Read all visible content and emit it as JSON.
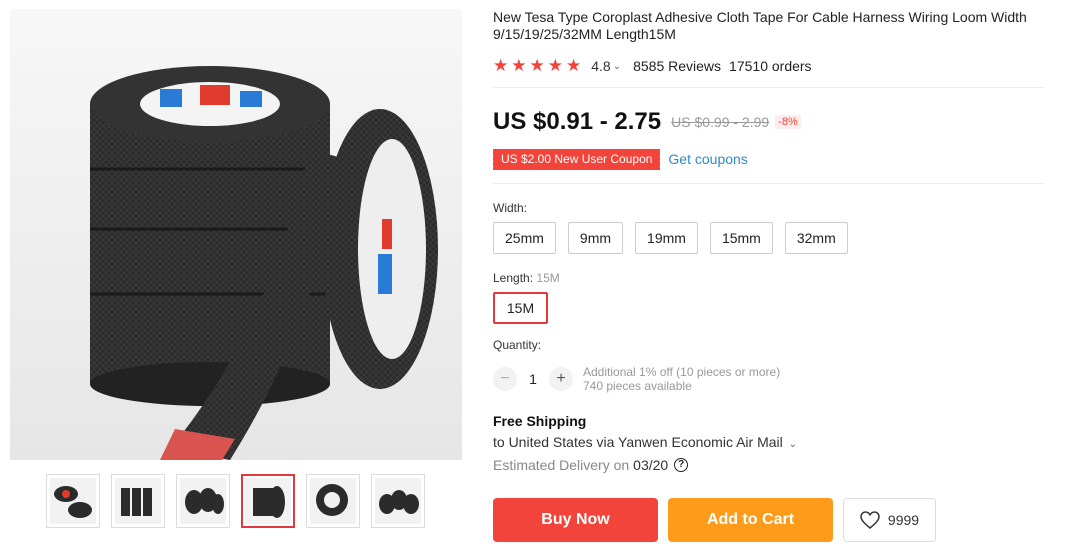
{
  "gallery": {
    "main_image_alt": "Black cloth adhesive tape rolls",
    "thumbnails": [
      "thumb-1",
      "thumb-2",
      "thumb-3",
      "thumb-4",
      "thumb-5",
      "thumb-6"
    ],
    "active_thumbnail": 3
  },
  "product": {
    "title": "New Tesa Type Coroplast Adhesive Cloth Tape For Cable Harness Wiring Loom Width 9/15/19/25/32MM Length15M",
    "rating": "4.8",
    "rating_caret": "⌄",
    "stars": [
      "★",
      "★",
      "★",
      "★",
      "★"
    ],
    "reviews": "8585 Reviews",
    "orders": "17510 orders"
  },
  "pricing": {
    "price": "US $0.91 - 2.75",
    "old_price": "US $0.99 - 2.99",
    "discount": "-8%",
    "coupon": "US $2.00 New User Coupon",
    "get_coupons": "Get coupons"
  },
  "options": {
    "width_label": "Width:",
    "widths": [
      "25mm",
      "9mm",
      "19mm",
      "15mm",
      "32mm"
    ],
    "length_label": "Length:",
    "length_selected": "15M",
    "lengths": [
      "15M"
    ],
    "quantity_label": "Quantity:",
    "quantity_value": "1",
    "minus": "−",
    "plus": "+",
    "quantity_note": "Additional 1% off (10 pieces or more)",
    "available": "740 pieces available"
  },
  "shipping": {
    "title": "Free Shipping",
    "route": "to United States via Yanwen Economic Air Mail",
    "route_caret": "⌄",
    "estimated_label": "Estimated Delivery on",
    "date": "03/20",
    "help": "?"
  },
  "actions": {
    "buy_now": "Buy Now",
    "add_to_cart": "Add to Cart",
    "wishlist_count": "9999"
  },
  "colors": {
    "accent_red": "#f2443a",
    "cart_orange": "#ff9b1a",
    "link_blue": "#2e8bc9"
  }
}
